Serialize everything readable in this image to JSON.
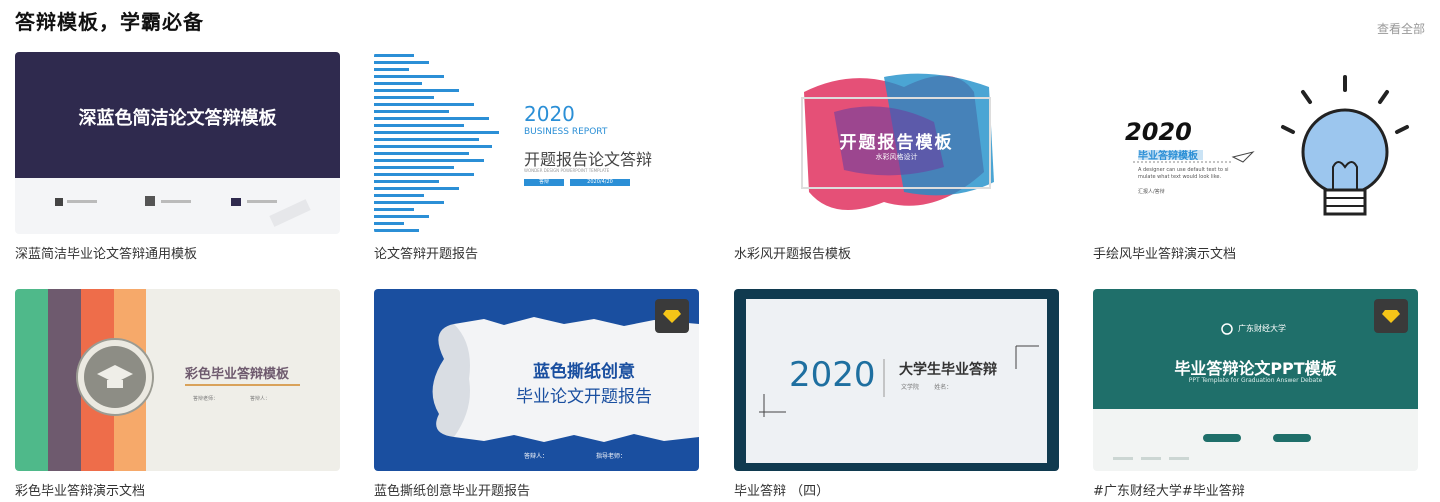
{
  "section": {
    "title": "答辩模板，学霸必备",
    "view_all": "查看全部"
  },
  "cards": [
    {
      "caption": "深蓝简洁毕业论文答辩通用模板",
      "thumb_title": "深蓝色简洁论文答辩模板"
    },
    {
      "caption": "论文答辩开题报告",
      "thumb_year": "2020",
      "thumb_sub": "BUSINESS REPORT",
      "thumb_title": "开题报告论文答辩",
      "thumb_small": "WONDER DESIGN POWERPOINT TEMPLATE",
      "thumb_btn1": "答辩",
      "thumb_btn2": "2020/4/20"
    },
    {
      "caption": "水彩风开题报告模板",
      "thumb_title": "开题报告模板",
      "thumb_sub": "水彩风格设计"
    },
    {
      "caption": "手绘风毕业答辩演示文档",
      "thumb_year": "2020",
      "thumb_title": "毕业答辩模板",
      "thumb_desc1": "A designer can use default text to si",
      "thumb_desc2": "mulate what text would look like.",
      "thumb_name": "汇报人/答辩"
    },
    {
      "caption": "彩色毕业答辩演示文档",
      "thumb_title": "彩色毕业答辩模板",
      "thumb_meta1": "答辩老师：",
      "thumb_meta2": "答辩人："
    },
    {
      "caption": "蓝色撕纸创意毕业开题报告",
      "thumb_title1": "蓝色撕纸创意",
      "thumb_title2": "毕业论文开题报告",
      "thumb_meta1": "答辩人：",
      "thumb_meta2": "指导老师：",
      "vip": true
    },
    {
      "caption": "毕业答辩 （四）",
      "thumb_year": "2020",
      "thumb_title": "大学生毕业答辩",
      "thumb_meta": "文学院        姓名：",
      "vip": false
    },
    {
      "caption": "#广东财经大学#毕业答辩",
      "thumb_school": "广东财经大学",
      "thumb_title": "毕业答辩论文PPT模板",
      "thumb_sub": "PPT Template for Graduation Answer Debate",
      "vip": true
    }
  ],
  "colors": {
    "navy": "#2f2a4e",
    "vip_gold": "#f5c518",
    "teal": "#1f6f6a",
    "blue": "#1a4fa0"
  }
}
